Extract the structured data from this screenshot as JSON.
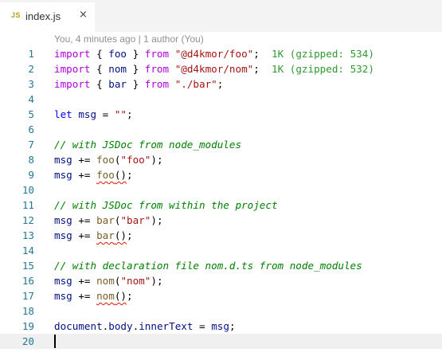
{
  "tab": {
    "icon": "JS",
    "label": "index.js",
    "close": "×"
  },
  "codelens": "You, 4 minutes ago | 1 author (You)",
  "lines": [
    {
      "n": "1",
      "tokens": [
        [
          "import",
          "kw2"
        ],
        [
          " { ",
          "plain"
        ],
        [
          "foo",
          "var"
        ],
        [
          " } ",
          "plain"
        ],
        [
          "from",
          "kw2"
        ],
        [
          " ",
          "plain"
        ],
        [
          "\"@d4kmor/foo\"",
          "str"
        ],
        [
          ";",
          "plain"
        ],
        [
          "  1K (gzipped: 534)",
          "hint"
        ]
      ]
    },
    {
      "n": "2",
      "tokens": [
        [
          "import",
          "kw2"
        ],
        [
          " { ",
          "plain"
        ],
        [
          "nom",
          "var"
        ],
        [
          " } ",
          "plain"
        ],
        [
          "from",
          "kw2"
        ],
        [
          " ",
          "plain"
        ],
        [
          "\"@d4kmor/nom\"",
          "str"
        ],
        [
          ";",
          "plain"
        ],
        [
          "  1K (gzipped: 532)",
          "hint"
        ]
      ]
    },
    {
      "n": "3",
      "tokens": [
        [
          "import",
          "kw2"
        ],
        [
          " { ",
          "plain"
        ],
        [
          "bar",
          "var"
        ],
        [
          " } ",
          "plain"
        ],
        [
          "from",
          "kw2"
        ],
        [
          " ",
          "plain"
        ],
        [
          "\"./bar\"",
          "str"
        ],
        [
          ";",
          "plain"
        ]
      ]
    },
    {
      "n": "4",
      "tokens": []
    },
    {
      "n": "5",
      "tokens": [
        [
          "let",
          "kw"
        ],
        [
          " ",
          "plain"
        ],
        [
          "msg",
          "var"
        ],
        [
          " = ",
          "plain"
        ],
        [
          "\"\"",
          "str"
        ],
        [
          ";",
          "plain"
        ]
      ]
    },
    {
      "n": "6",
      "tokens": []
    },
    {
      "n": "7",
      "tokens": [
        [
          "// with JSDoc from node_modules",
          "cmt"
        ]
      ]
    },
    {
      "n": "8",
      "tokens": [
        [
          "msg",
          "var"
        ],
        [
          " += ",
          "plain"
        ],
        [
          "foo",
          "fn"
        ],
        [
          "(",
          "plain"
        ],
        [
          "\"foo\"",
          "str"
        ],
        [
          ");",
          "plain"
        ]
      ]
    },
    {
      "n": "9",
      "tokens": [
        [
          "msg",
          "var"
        ],
        [
          " += ",
          "plain"
        ],
        [
          "foo",
          "fn squig"
        ],
        [
          "()",
          "plain squig"
        ],
        [
          ";",
          "plain"
        ]
      ]
    },
    {
      "n": "10",
      "tokens": []
    },
    {
      "n": "11",
      "tokens": [
        [
          "// with JSDoc from within the project",
          "cmt"
        ]
      ]
    },
    {
      "n": "12",
      "tokens": [
        [
          "msg",
          "var"
        ],
        [
          " += ",
          "plain"
        ],
        [
          "bar",
          "fn"
        ],
        [
          "(",
          "plain"
        ],
        [
          "\"bar\"",
          "str"
        ],
        [
          ");",
          "plain"
        ]
      ]
    },
    {
      "n": "13",
      "tokens": [
        [
          "msg",
          "var"
        ],
        [
          " += ",
          "plain"
        ],
        [
          "bar",
          "fn squig"
        ],
        [
          "()",
          "plain squig"
        ],
        [
          ";",
          "plain"
        ]
      ]
    },
    {
      "n": "14",
      "tokens": []
    },
    {
      "n": "15",
      "tokens": [
        [
          "// with declaration file nom.d.ts from node_modules",
          "cmt"
        ]
      ]
    },
    {
      "n": "16",
      "tokens": [
        [
          "msg",
          "var"
        ],
        [
          " += ",
          "plain"
        ],
        [
          "nom",
          "fn"
        ],
        [
          "(",
          "plain"
        ],
        [
          "\"nom\"",
          "str"
        ],
        [
          ");",
          "plain"
        ]
      ]
    },
    {
      "n": "17",
      "tokens": [
        [
          "msg",
          "var"
        ],
        [
          " += ",
          "plain"
        ],
        [
          "nom",
          "fn squig"
        ],
        [
          "()",
          "plain squig"
        ],
        [
          ";",
          "plain"
        ]
      ]
    },
    {
      "n": "18",
      "tokens": []
    },
    {
      "n": "19",
      "tokens": [
        [
          "document",
          "var"
        ],
        [
          ".",
          "plain"
        ],
        [
          "body",
          "var"
        ],
        [
          ".",
          "plain"
        ],
        [
          "innerText",
          "var"
        ],
        [
          " = ",
          "plain"
        ],
        [
          "msg",
          "var"
        ],
        [
          ";",
          "plain"
        ]
      ]
    },
    {
      "n": "20",
      "tokens": [],
      "current": true
    }
  ],
  "colors": {
    "line_number": "#237893",
    "keyword": "#af00db",
    "string": "#a31515",
    "comment": "#008000",
    "import_cost_hint": "#2e9a2e",
    "error_squiggle": "#e51400"
  }
}
